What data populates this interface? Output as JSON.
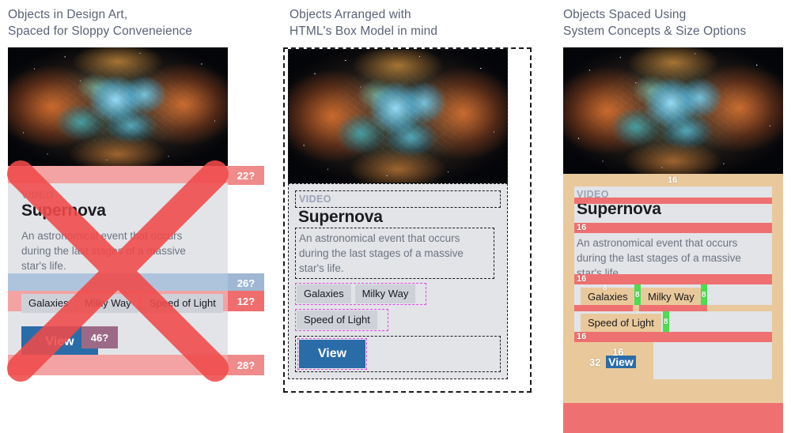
{
  "columns": [
    {
      "id": "design-art",
      "heading": "Objects in Design Art,\nSpaced for Sloppy Conveneience"
    },
    {
      "id": "box-model",
      "heading": "Objects Arranged with\nHTML's Box Model in mind"
    },
    {
      "id": "system",
      "heading": "Objects Spaced Using\nSystem Concepts & Size Options"
    }
  ],
  "card": {
    "image_alt": "crab-nebula-photo",
    "eyebrow": "VIDEO",
    "title": "Supernova",
    "description": "An astronomical event that occurs during the last stages of a massive star's life.",
    "chips": [
      "Galaxies",
      "Milky Way",
      "Speed of Light"
    ],
    "button_label": "View"
  },
  "card1": {
    "marked_invalid": true,
    "measurements": [
      "22?",
      "26?",
      "12?",
      "46?",
      "28?"
    ]
  },
  "card3": {
    "measurements": {
      "image_to_eyebrow": "16",
      "title_to_desc": "16",
      "desc_to_chips": "16",
      "chip_gap_1": "8",
      "chip_gap_2": "8",
      "chip_gap_3": "8",
      "chip_inset": "8",
      "chip_row_gap": "8",
      "chips_to_button": "16",
      "button_pad_top": "16",
      "button_pad_left": "32"
    }
  },
  "colors": {
    "heading_text": "#5b6378",
    "card_body": "#e2e4e8",
    "chip": "#ced2d8",
    "button": "#2a6ca8",
    "spacing_red": "#ef7070",
    "spacing_green": "#4cdd52",
    "padding_tan": "#e9c99b",
    "invalid_x": "#f04a4a",
    "dash_black": "#1a1a1a",
    "dash_magenta": "#e24be2"
  }
}
